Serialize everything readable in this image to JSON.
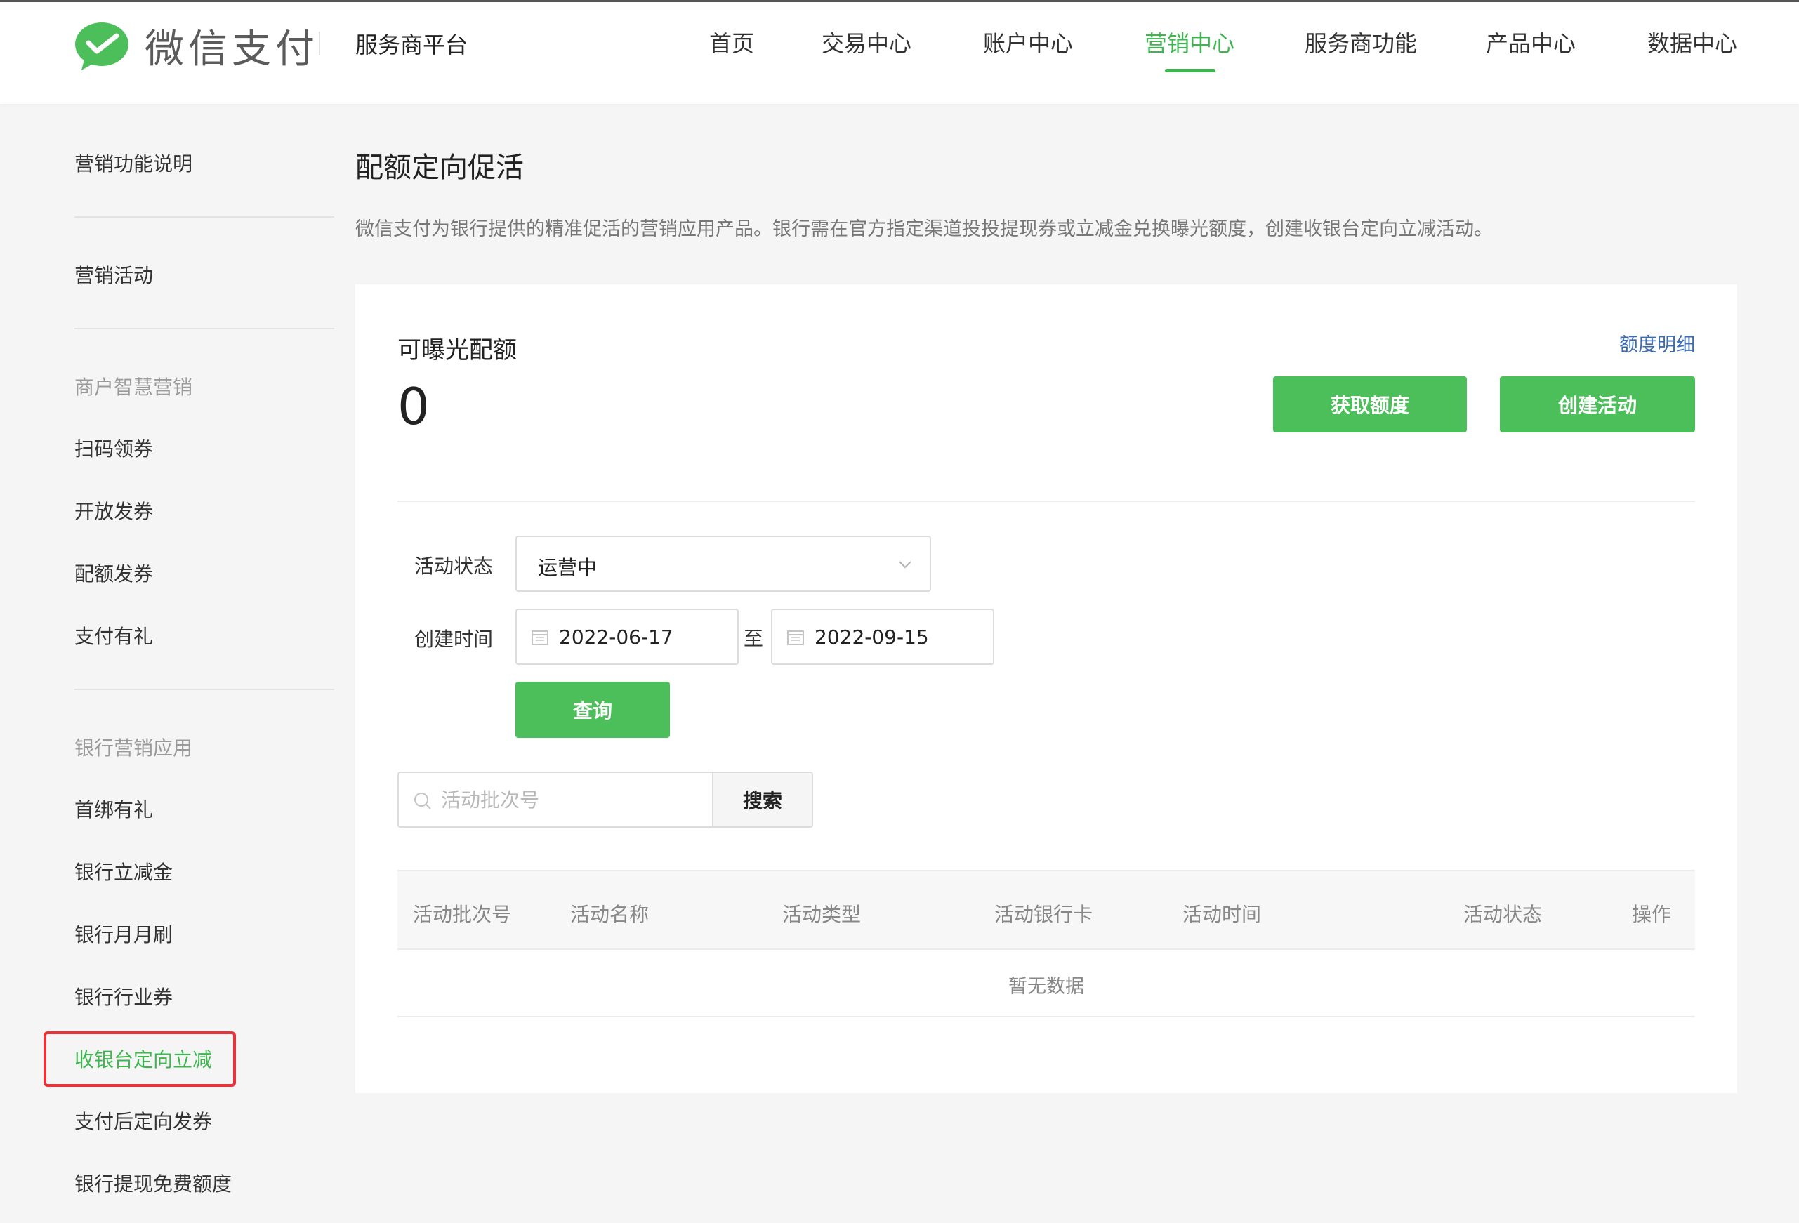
{
  "header": {
    "logo_text": "微信支付",
    "platform_name": "服务商平台",
    "nav": [
      {
        "label": "首页"
      },
      {
        "label": "交易中心"
      },
      {
        "label": "账户中心"
      },
      {
        "label": "营销中心"
      },
      {
        "label": "服务商功能"
      },
      {
        "label": "产品中心"
      },
      {
        "label": "数据中心"
      }
    ],
    "active_nav": "营销中心"
  },
  "sidebar": {
    "items": [
      {
        "label": "营销功能说明"
      },
      {
        "label": "营销活动"
      },
      {
        "label": "商户智慧营销"
      },
      {
        "label": "扫码领券"
      },
      {
        "label": "开放发券"
      },
      {
        "label": "配额发券"
      },
      {
        "label": "支付有礼"
      },
      {
        "label": "银行营销应用"
      },
      {
        "label": "首绑有礼"
      },
      {
        "label": "银行立减金"
      },
      {
        "label": "银行月月刷"
      },
      {
        "label": "银行行业券"
      },
      {
        "label": "收银台定向立减"
      },
      {
        "label": "支付后定向发券"
      },
      {
        "label": "银行提现免费额度"
      }
    ],
    "active_item": "收银台定向立减"
  },
  "main": {
    "title": "配额定向促活",
    "description": "微信支付为银行提供的精准促活的营销应用产品。银行需在官方指定渠道投投提现券或立减金兑换曝光额度，创建收银台定向立减活动。",
    "quota": {
      "label": "可曝光配额",
      "value": "0",
      "detail_link": "额度明细"
    },
    "buttons": {
      "get_quota": "获取额度",
      "create_activity": "创建活动",
      "query": "查询",
      "search": "搜索"
    },
    "filters": {
      "status_label": "活动状态",
      "status_value": "运营中",
      "created_label": "创建时间",
      "date_from": "2022-06-17",
      "date_sep": "至",
      "date_to": "2022-09-15"
    },
    "search": {
      "placeholder": "活动批次号"
    },
    "table": {
      "columns": [
        "活动批次号",
        "活动名称",
        "活动类型",
        "活动银行卡",
        "活动时间",
        "活动状态",
        "操作"
      ],
      "empty_text": "暂无数据"
    }
  },
  "colors": {
    "brand_green": "#4cbf5b",
    "active_text": "#3fb550",
    "link_blue": "#3b6cb4",
    "highlight_red": "#e8333b"
  }
}
